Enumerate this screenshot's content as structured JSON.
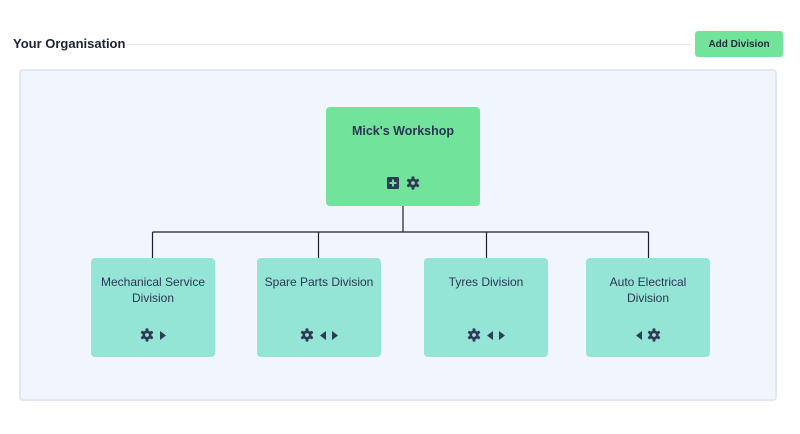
{
  "header": {
    "title": "Your Organisation",
    "add_division_label": "Add Division"
  },
  "org_chart": {
    "root": {
      "name": "Mick's Workshop",
      "actions": [
        "plus-square-icon",
        "gear-icon"
      ]
    },
    "divisions": [
      {
        "name": "Mechanical Service Division",
        "actions": [
          "gear-icon",
          "caret-right-icon"
        ]
      },
      {
        "name": "Spare Parts Division",
        "actions": [
          "gear-icon",
          "caret-left-icon",
          "caret-right-icon"
        ]
      },
      {
        "name": "Tyres Division",
        "actions": [
          "gear-icon",
          "caret-left-icon",
          "caret-right-icon"
        ]
      },
      {
        "name": "Auto Electrical Division",
        "actions": [
          "caret-left-icon",
          "gear-icon"
        ]
      }
    ]
  },
  "colors": {
    "accent": "#72e39a",
    "division_node": "#94e5d6",
    "canvas_background": "#f1f5fc",
    "icon": "#2f3a55"
  }
}
